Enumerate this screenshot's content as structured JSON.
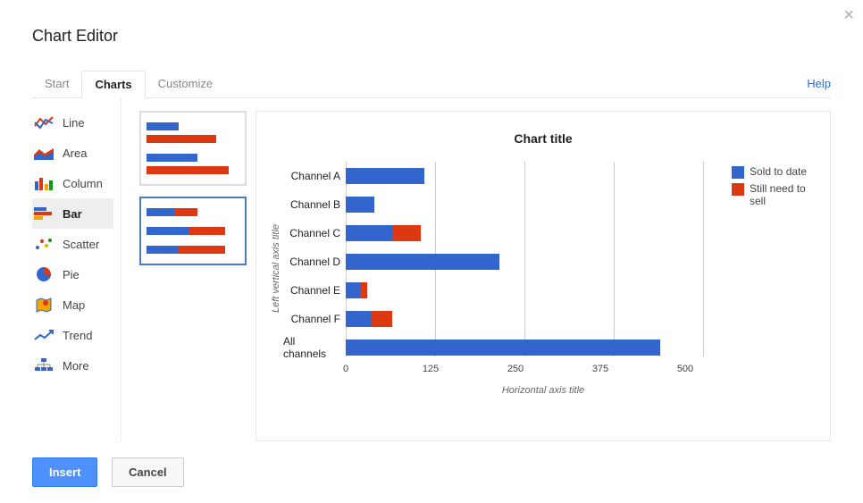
{
  "dialog_title": "Chart Editor",
  "close": "×",
  "tabs": {
    "start": "Start",
    "charts": "Charts",
    "customize": "Customize"
  },
  "help_link": "Help",
  "chart_types": {
    "line": "Line",
    "area": "Area",
    "column": "Column",
    "bar": "Bar",
    "scatter": "Scatter",
    "pie": "Pie",
    "map": "Map",
    "trend": "Trend",
    "more": "More"
  },
  "chart_data": {
    "type": "bar",
    "title": "Chart title",
    "xlabel": "Horizontal axis title",
    "ylabel": "Left vertical axis title",
    "ticks": [
      0,
      125,
      250,
      375,
      500
    ],
    "legend_position": "right",
    "categories": [
      "Channel A",
      "Channel B",
      "Channel C",
      "Channel D",
      "Channel E",
      "Channel F",
      "All channels"
    ],
    "series": [
      {
        "name": "Sold to date",
        "color": "#3366cc",
        "values": [
          110,
          40,
          65,
          215,
          20,
          35,
          440
        ]
      },
      {
        "name": "Still need to sell",
        "color": "#dc3912",
        "values": [
          0,
          0,
          40,
          0,
          10,
          30,
          0
        ]
      }
    ]
  },
  "buttons": {
    "insert": "Insert",
    "cancel": "Cancel"
  }
}
